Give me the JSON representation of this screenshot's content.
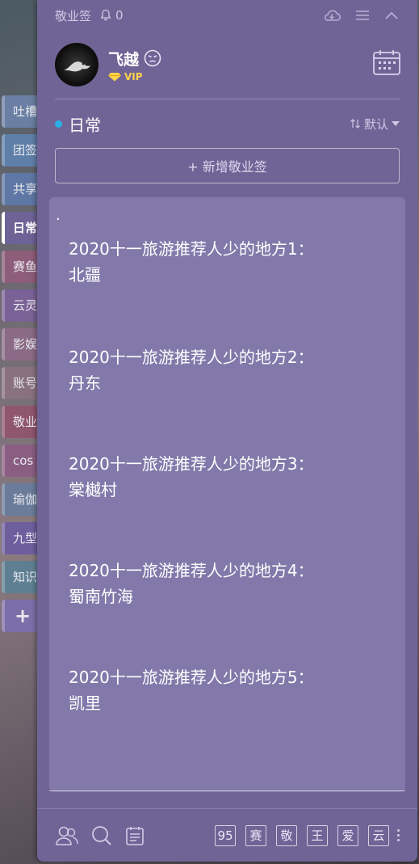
{
  "colors": {
    "panel": "#706496",
    "card": "#8279aa",
    "accent_dot": "#2ab0e6",
    "vip": "#ffd24a"
  },
  "side_tabs": [
    {
      "label": "吐槽",
      "color": "#6a7fa3"
    },
    {
      "label": "团签",
      "color": "#5e7fa8"
    },
    {
      "label": "共享",
      "color": "#5f77a4"
    },
    {
      "label": "日常",
      "color": "#6d6396",
      "active": true
    },
    {
      "label": "赛鱼",
      "color": "#8d5d7a"
    },
    {
      "label": "云灵",
      "color": "#7a6296"
    },
    {
      "label": "影娱",
      "color": "#8a6a86"
    },
    {
      "label": "账号",
      "color": "#8a7180"
    },
    {
      "label": "敬业",
      "color": "#8f566e"
    },
    {
      "label": "cos",
      "color": "#8a5e82"
    },
    {
      "label": "瑜伽",
      "color": "#6a7c9a"
    },
    {
      "label": "九型",
      "color": "#6e5e9e"
    },
    {
      "label": "知识",
      "color": "#5e7f92"
    }
  ],
  "side_add_label": "+",
  "topbar": {
    "app_title": "敬业签",
    "bell_count": "0"
  },
  "user": {
    "name": "飞越",
    "vip_label": "VIP"
  },
  "section": {
    "title": "日常",
    "sort_label": "默认"
  },
  "add_note_label": "+ 新增敬业签",
  "note": {
    "dot": ".",
    "items": [
      "2020十一旅游推荐人少的地方1：\n北疆",
      "2020十一旅游推荐人少的地方2：\n丹东",
      "2020十一旅游推荐人少的地方3：\n棠樾村",
      "2020十一旅游推荐人少的地方4：\n蜀南竹海",
      "2020十一旅游推荐人少的地方5：\n凯里"
    ]
  },
  "quick_keys": [
    "95",
    "赛",
    "敬",
    "王",
    "爱",
    "云"
  ]
}
